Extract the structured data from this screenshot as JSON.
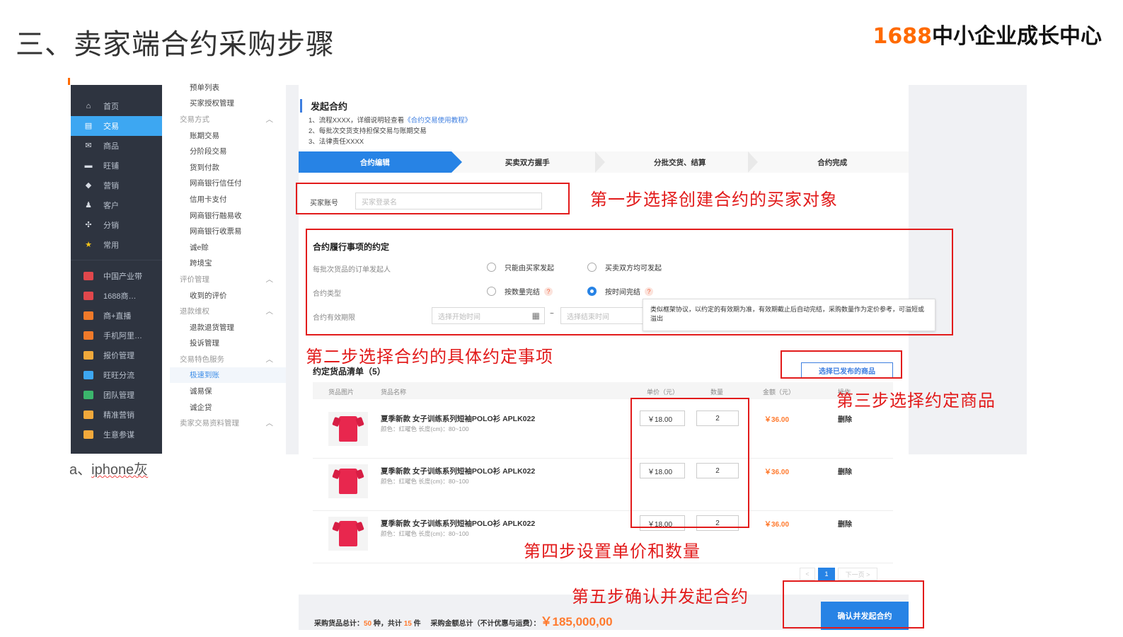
{
  "slide": {
    "title": "三、卖家端合约采购步骤",
    "brand_number": "1688",
    "brand_text": "中小企业成长中心"
  },
  "left_nav": {
    "items": [
      {
        "label": "首页",
        "icon": "home-icon",
        "glyph": "⌂"
      },
      {
        "label": "交易",
        "icon": "trade-icon",
        "glyph": "▤",
        "active": true
      },
      {
        "label": "商品",
        "icon": "goods-icon",
        "glyph": "✉"
      },
      {
        "label": "旺铺",
        "icon": "shop-icon",
        "glyph": "▬"
      },
      {
        "label": "营销",
        "icon": "tag-icon",
        "glyph": "◆"
      },
      {
        "label": "客户",
        "icon": "user-icon",
        "glyph": "♟"
      },
      {
        "label": "分销",
        "icon": "distribute-icon",
        "glyph": "✣"
      },
      {
        "label": "常用",
        "icon": "star-icon",
        "glyph": "★"
      }
    ],
    "apps": [
      {
        "label": "中国产业带",
        "icon": "industry-belt-icon",
        "color": "#e0474c"
      },
      {
        "label": "1688商…",
        "icon": "business-icon",
        "color": "#e0474c"
      },
      {
        "label": "商+直播",
        "icon": "live-icon",
        "color": "#f07a2a"
      },
      {
        "label": "手机阿里…",
        "icon": "mobile-ali-icon",
        "color": "#f07a2a"
      },
      {
        "label": "报价管理",
        "icon": "quote-icon",
        "color": "#f2a93b"
      },
      {
        "label": "旺旺分流",
        "icon": "wangwang-icon",
        "color": "#3da7f2"
      },
      {
        "label": "团队管理",
        "icon": "team-icon",
        "color": "#3bb56c"
      },
      {
        "label": "精准营销",
        "icon": "precise-marketing-icon",
        "color": "#f2a93b"
      },
      {
        "label": "生意参谋",
        "icon": "business-advisor-icon",
        "color": "#f2a93b"
      }
    ]
  },
  "caption": {
    "prefix": "a、",
    "text": "iphone灰"
  },
  "sub_nav": {
    "items": [
      {
        "label": "预单列表",
        "type": "item"
      },
      {
        "label": "买家授权管理",
        "type": "item"
      },
      {
        "label": "交易方式",
        "type": "group"
      },
      {
        "label": "账期交易",
        "type": "item"
      },
      {
        "label": "分阶段交易",
        "type": "item"
      },
      {
        "label": "货到付款",
        "type": "item"
      },
      {
        "label": "网商银行信任付",
        "type": "item"
      },
      {
        "label": "信用卡支付",
        "type": "item"
      },
      {
        "label": "网商银行融易收",
        "type": "item"
      },
      {
        "label": "网商银行收票易",
        "type": "item"
      },
      {
        "label": "诚e赊",
        "type": "item"
      },
      {
        "label": "跨境宝",
        "type": "item"
      },
      {
        "label": "评价管理",
        "type": "group"
      },
      {
        "label": "收到的评价",
        "type": "item"
      },
      {
        "label": "退款维权",
        "type": "group"
      },
      {
        "label": "退款退货管理",
        "type": "item"
      },
      {
        "label": "投诉管理",
        "type": "item"
      },
      {
        "label": "交易特色服务",
        "type": "group"
      },
      {
        "label": "极速到账",
        "type": "item",
        "active": true
      },
      {
        "label": "诚易保",
        "type": "item"
      },
      {
        "label": "诚企贷",
        "type": "item"
      },
      {
        "label": "卖家交易资料管理",
        "type": "group"
      }
    ],
    "collapse_glyph": "︿"
  },
  "contract": {
    "title": "发起合约",
    "notes": [
      {
        "text": "1、流程XXXX，详细说明轻查看",
        "link": "《合约交易使用教程》"
      },
      {
        "text": "2、每批次交货支持担保交易与账期交易",
        "link": ""
      },
      {
        "text": "3、法律责任XXXX",
        "link": ""
      }
    ],
    "steps": [
      "合约编辑",
      "买卖双方握手",
      "分批交货、结算",
      "合约完成"
    ],
    "buyer": {
      "label": "买家账号",
      "placeholder": "买家登录名"
    },
    "terms": {
      "title": "合约履行事项的约定",
      "initiator_label": "每批次货品的订单发起人",
      "initiator_options": [
        "只能由买家发起",
        "买卖双方均可发起"
      ],
      "type_label": "合约类型",
      "type_options": [
        "按数量完结",
        "按时间完结"
      ],
      "type_selected": "按时间完结",
      "validity_label": "合约有效期限",
      "start_placeholder": "选择开始时间",
      "end_placeholder": "选择结束时间",
      "range_sep": "~",
      "tooltip": "类似框架协议，以约定的有效期为准，有效期截止后自动完结，采购数量作为定价参考，可溢短或溢出",
      "help": "?"
    },
    "goods": {
      "title": "约定货品清单（5）",
      "pick_button": "选择已发布的商品",
      "columns": [
        "货品图片",
        "货品名称",
        "单价（元）",
        "数量",
        "金额（元）",
        "操作"
      ],
      "rows": [
        {
          "name": "夏季新款 女子训练系列短袖POLO衫 APLK022",
          "spec": "颜色：红曜色    长度(cm)：80~100",
          "price": "￥18.00",
          "qty": "2",
          "amount": "￥36.00",
          "action": "删除"
        },
        {
          "name": "夏季新款 女子训练系列短袖POLO衫 APLK022",
          "spec": "颜色：红曜色    长度(cm)：80~100",
          "price": "￥18.00",
          "qty": "2",
          "amount": "￥36.00",
          "action": "删除"
        },
        {
          "name": "夏季新款 女子训练系列短袖POLO衫 APLK022",
          "spec": "颜色：红曜色    长度(cm)：80~100",
          "price": "￥18.00",
          "qty": "2",
          "amount": "￥36.00",
          "action": "删除"
        }
      ],
      "pager": {
        "prev": "<",
        "current": "1",
        "next": "下一页 >"
      }
    },
    "footer": {
      "summary_label": "采购货品总计：",
      "kinds": "50",
      "kinds_unit": "种，共计",
      "pieces": "15",
      "pieces_unit": "件",
      "amount_label": "采购金额总计（不计优惠与运费）：",
      "amount": "￥185,000,00",
      "confirm_button": "确认并发起合约"
    }
  },
  "annotations": {
    "step1": "第一步选择创建合约的买家对象",
    "step2": "第二步选择合约的具体约定事项",
    "step3": "第三步选择约定商品",
    "step4": "第四步设置单价和数量",
    "step5": "第五步确认并发起合约",
    "color": "#e21b1b"
  }
}
